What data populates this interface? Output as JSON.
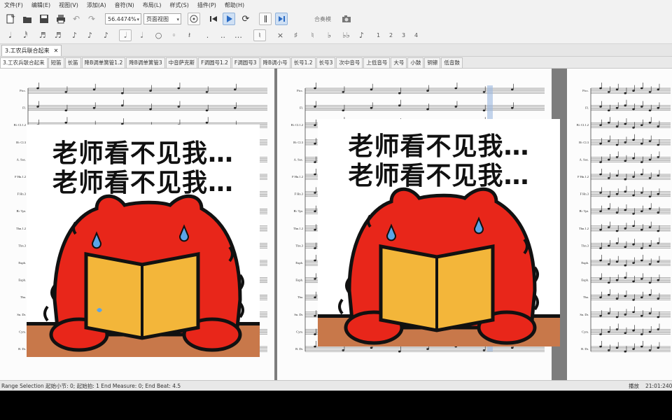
{
  "menu": [
    "文件(F)",
    "编辑(E)",
    "视图(V)",
    "添加(A)",
    "音符(N)",
    "布局(L)",
    "样式(S)",
    "插件(P)",
    "帮助(H)"
  ],
  "toolbar": {
    "zoom_value": "56.4474%",
    "view_mode": "页面视图",
    "mixer_label": "合奏模"
  },
  "palette": {
    "voices": [
      "1",
      "2",
      "3",
      "4"
    ]
  },
  "document_tab": "3.工农兵联合起来",
  "part_tabs": [
    "3.工农兵联合起来",
    "短笛",
    "长笛",
    "降B调单簧管1.2",
    "降B调单簧管3",
    "中音萨克斯",
    "F调圆号1.2",
    "F调圆号3",
    "降B调小号",
    "长号1.2",
    "长号3",
    "次中音号",
    "上低音号",
    "大号",
    "小鼓",
    "铜镲",
    "低音鼓"
  ],
  "page1_instruments": [
    "Picc.",
    "Fl.",
    "B♭ Cl.1.2",
    "B♭ Cl.3",
    "A. Sax.",
    "F Hn.1.2",
    "F Hn.3",
    "B♭ Tpt.",
    "Tbn.1.2",
    "Tbn.3",
    "Euph.",
    "Euph.",
    "Tba.",
    "Sn. Dr.",
    "Cym.",
    "B. Dr."
  ],
  "sticker": {
    "line1": "老师看不见我…",
    "line2": "老师看不见我…"
  },
  "status": {
    "selection": "Range Selection 起始小节: 0; 起始拍: 1 End Measure: 0; End Beat: 4.5",
    "mode": "播放",
    "time": "21:01:240"
  },
  "colors": {
    "frog_red": "#e8261a",
    "book_yellow": "#f3b63a",
    "table_brown": "#c8784a",
    "selection_blue": "#9bb8e0"
  }
}
